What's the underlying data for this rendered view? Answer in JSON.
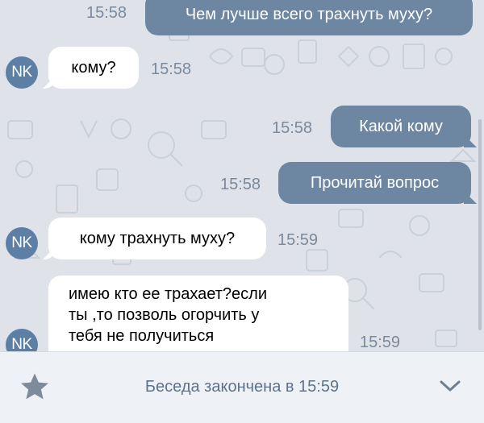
{
  "messages": [
    {
      "text": "Чем лучше всего трахнуть муху?",
      "time": "15:58"
    },
    {
      "text": "кому?",
      "time": "15:58",
      "avatar": "NK"
    },
    {
      "text": "Какой кому",
      "time": "15:58"
    },
    {
      "text": "Прочитай вопрос",
      "time": "15:58"
    },
    {
      "text": "кому трахнуть муху?",
      "time": "15:59",
      "avatar": "NK"
    },
    {
      "line1": "имею кто ее трахает?если",
      "line2": "ты ,то позволь огорчить у",
      "line3": "тебя не получиться",
      "time": "15:59",
      "avatar": "NK"
    }
  ],
  "footer": {
    "status": "Беседа закончена в 15:59",
    "star_icon": "star-icon",
    "chevron_icon": "chevron-down-icon"
  },
  "colors": {
    "outgoing": "#6d86a1",
    "incoming": "#ffffff",
    "avatar": "#5d7fa6",
    "background": "#dfe3e9"
  }
}
